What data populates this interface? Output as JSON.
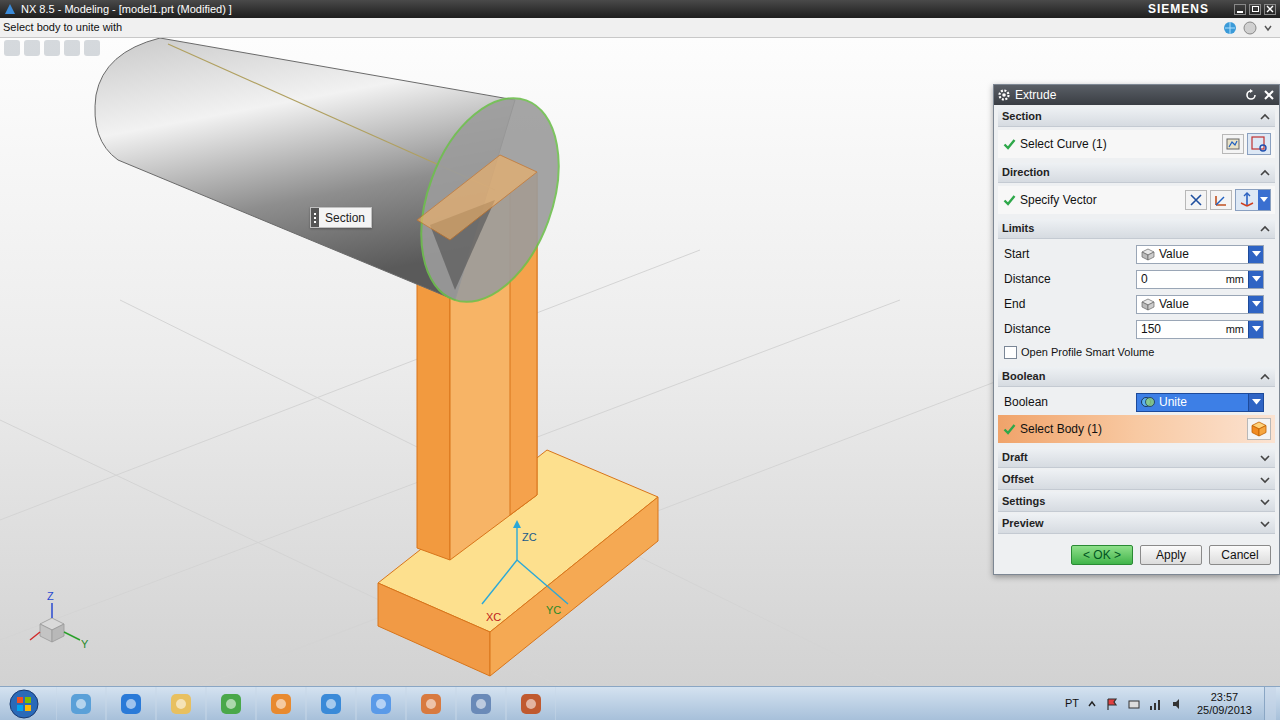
{
  "window": {
    "title": "NX 8.5 - Modeling - [model1.prt (Modified) ]",
    "brand": "SIEMENS"
  },
  "cue_line": "Select body to unite with",
  "viewport": {
    "section_label": "Section",
    "wcs_labels": {
      "z": "ZC",
      "x": "XC",
      "y": "YC"
    },
    "triad_labels": {
      "z": "Z",
      "y": "Y"
    }
  },
  "dialog": {
    "title": "Extrude",
    "groups": [
      {
        "title": "Section",
        "expanded": true,
        "rows": [
          {
            "kind": "selection",
            "label": "Select Curve (1)",
            "done": true,
            "highlighted": false
          }
        ]
      },
      {
        "title": "Direction",
        "expanded": true,
        "rows": [
          {
            "kind": "selection",
            "label": "Specify Vector",
            "done": true,
            "highlighted": false
          }
        ]
      },
      {
        "title": "Limits",
        "expanded": true,
        "rows": [
          {
            "kind": "dropdown",
            "label": "Start",
            "value": "Value",
            "highlighted": false
          },
          {
            "kind": "number",
            "label": "Distance",
            "value": "0",
            "unit": "mm"
          },
          {
            "kind": "dropdown",
            "label": "End",
            "value": "Value",
            "highlighted": false
          },
          {
            "kind": "number",
            "label": "Distance",
            "value": "150",
            "unit": "mm"
          },
          {
            "kind": "checkbox",
            "label": "Open Profile Smart Volume",
            "checked": false
          }
        ]
      },
      {
        "title": "Boolean",
        "expanded": true,
        "rows": [
          {
            "kind": "dropdown",
            "label": "Boolean",
            "value": "Unite",
            "highlighted": true
          },
          {
            "kind": "selection",
            "label": "Select Body (1)",
            "done": true,
            "highlighted": true
          }
        ]
      },
      {
        "title": "Draft",
        "expanded": false,
        "rows": []
      },
      {
        "title": "Offset",
        "expanded": false,
        "rows": []
      },
      {
        "title": "Settings",
        "expanded": false,
        "rows": []
      },
      {
        "title": "Preview",
        "expanded": false,
        "rows": []
      }
    ],
    "buttons": [
      {
        "label": "< OK >",
        "default": true
      },
      {
        "label": "Apply",
        "default": false
      },
      {
        "label": "Cancel",
        "default": false
      }
    ]
  },
  "taskbar": {
    "language": "PT",
    "time": "23:57",
    "date": "25/09/2013"
  }
}
